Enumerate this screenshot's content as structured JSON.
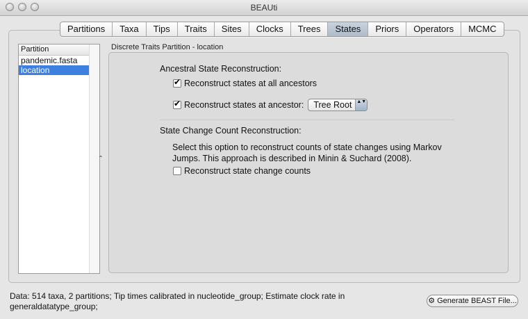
{
  "window": {
    "title": "BEAUti"
  },
  "tabs": [
    {
      "label": "Partitions"
    },
    {
      "label": "Taxa"
    },
    {
      "label": "Tips"
    },
    {
      "label": "Traits"
    },
    {
      "label": "Sites"
    },
    {
      "label": "Clocks"
    },
    {
      "label": "Trees"
    },
    {
      "label": "States",
      "active": true
    },
    {
      "label": "Priors"
    },
    {
      "label": "Operators"
    },
    {
      "label": "MCMC"
    }
  ],
  "partition_list": {
    "header": "Partition",
    "items": [
      {
        "label": "pandemic.fasta",
        "selected": false
      },
      {
        "label": "location",
        "selected": true
      }
    ],
    "split_handle": "ˆ"
  },
  "panel": {
    "title": "Discrete Traits Partition - location",
    "ancestral": {
      "label": "Ancestral State Reconstruction:",
      "all_ancestors": {
        "label": "Reconstruct states at all ancestors",
        "checked": true
      },
      "at_ancestor": {
        "label": "Reconstruct states at ancestor:",
        "checked": true,
        "selected": "Tree Root",
        "arrows": "▲▼"
      }
    },
    "state_change": {
      "label": "State Change Count Reconstruction:",
      "description": "Select this option to reconstruct counts of state changes using Markov Jumps. This approach is described in Minin & Suchard (2008).",
      "reconstruct_counts": {
        "label": "Reconstruct state change counts",
        "checked": false
      }
    }
  },
  "status": {
    "text": "Data: 514 taxa, 2 partitions; Tip times calibrated in nucleotide_group; Estimate clock rate in generaldatatype_group;"
  },
  "generate_button": {
    "label": "Generate BEAST File...",
    "icon": "gear-icon",
    "glyph": "⚙"
  }
}
